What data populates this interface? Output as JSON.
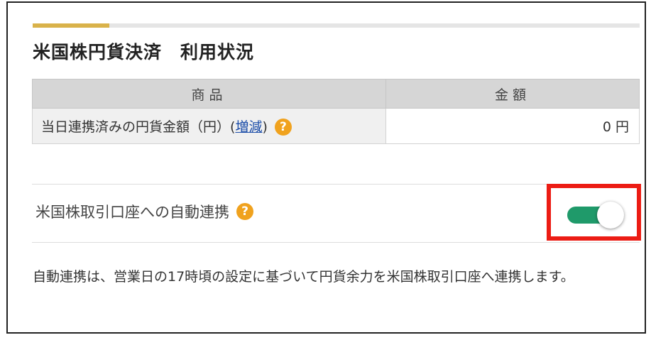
{
  "section": {
    "title": "米国株円貨決済　利用状況",
    "accent_color": "#d9b24a"
  },
  "usage_table": {
    "headers": {
      "product": "商品",
      "amount": "金額"
    },
    "rows": [
      {
        "label": "当日連携済みの円貨金額（円）",
        "link_open": "(",
        "link_text": "増減",
        "link_close": ")",
        "help_icon": "?",
        "amount": "0 円"
      }
    ]
  },
  "auto_link": {
    "label": "米国株取引口座への自動連携",
    "help_icon": "?",
    "toggle": {
      "state": "on",
      "on_color": "#1f9a6a"
    },
    "highlight_color": "#ec1c14"
  },
  "note": "自動連携は、営業日の17時頃の設定に基づいて円貨余力を米国株取引口座へ連携します。"
}
